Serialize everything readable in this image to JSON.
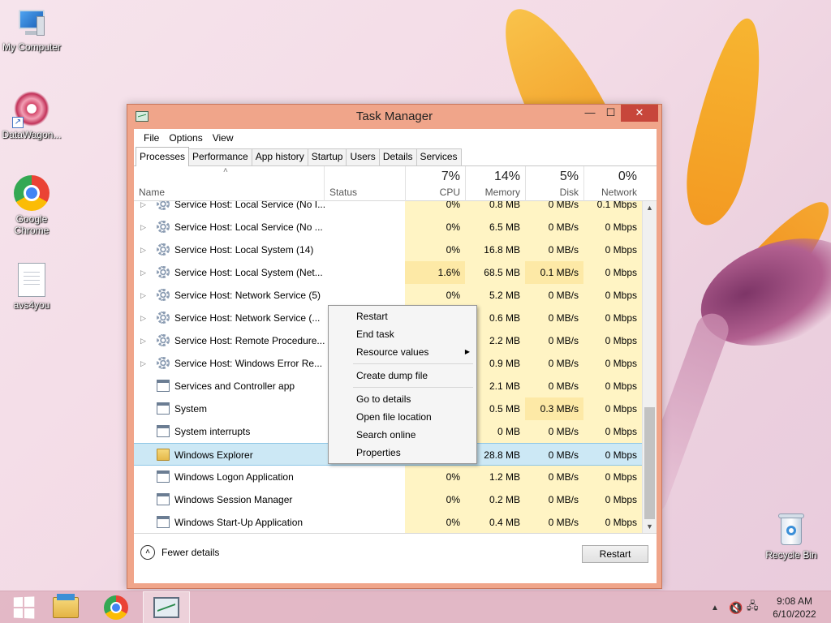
{
  "desktop": {
    "icons": [
      {
        "label": "My Computer"
      },
      {
        "label": "DataWagon..."
      },
      {
        "label": "Google Chrome"
      },
      {
        "label": "avs4you"
      },
      {
        "label": "Recycle Bin"
      }
    ]
  },
  "window": {
    "title": "Task Manager",
    "controls": {
      "minimize": "—",
      "maximize": "☐",
      "close": "✕"
    },
    "menu": [
      "File",
      "Options",
      "View"
    ],
    "tabs": [
      "Processes",
      "Performance",
      "App history",
      "Startup",
      "Users",
      "Details",
      "Services"
    ],
    "active_tab": "Processes",
    "columns": {
      "name": "Name",
      "status": "Status",
      "cpu": {
        "pct": "7%",
        "label": "CPU"
      },
      "memory": {
        "pct": "14%",
        "label": "Memory"
      },
      "disk": {
        "pct": "5%",
        "label": "Disk"
      },
      "network": {
        "pct": "0%",
        "label": "Network"
      }
    },
    "rows": [
      {
        "name": "Service Host: Local Service (No I...",
        "cpu": "0%",
        "memory": "0.8 MB",
        "disk": "0 MB/s",
        "network": "0.1 Mbps",
        "expand": true,
        "icon": "gear"
      },
      {
        "name": "Service Host: Local Service (No ...",
        "cpu": "0%",
        "memory": "6.5 MB",
        "disk": "0 MB/s",
        "network": "0 Mbps",
        "expand": true,
        "icon": "gear"
      },
      {
        "name": "Service Host: Local System (14)",
        "cpu": "0%",
        "memory": "16.8 MB",
        "disk": "0 MB/s",
        "network": "0 Mbps",
        "expand": true,
        "icon": "gear"
      },
      {
        "name": "Service Host: Local System (Net...",
        "cpu": "1.6%",
        "memory": "68.5 MB",
        "disk": "0.1 MB/s",
        "network": "0 Mbps",
        "expand": true,
        "icon": "gear"
      },
      {
        "name": "Service Host: Network Service (5)",
        "cpu": "0%",
        "memory": "5.2 MB",
        "disk": "0 MB/s",
        "network": "0 Mbps",
        "expand": true,
        "icon": "gear"
      },
      {
        "name": "Service Host: Network Service (...",
        "cpu": "",
        "memory": "0.6 MB",
        "disk": "0 MB/s",
        "network": "0 Mbps",
        "expand": true,
        "icon": "gear"
      },
      {
        "name": "Service Host: Remote Procedure...",
        "cpu": "",
        "memory": "2.2 MB",
        "disk": "0 MB/s",
        "network": "0 Mbps",
        "expand": true,
        "icon": "gear"
      },
      {
        "name": "Service Host: Windows Error Re...",
        "cpu": "",
        "memory": "0.9 MB",
        "disk": "0 MB/s",
        "network": "0 Mbps",
        "expand": true,
        "icon": "gear"
      },
      {
        "name": "Services and Controller app",
        "cpu": "",
        "memory": "2.1 MB",
        "disk": "0 MB/s",
        "network": "0 Mbps",
        "expand": false,
        "icon": "app"
      },
      {
        "name": "System",
        "cpu": "",
        "memory": "0.5 MB",
        "disk": "0.3 MB/s",
        "network": "0 Mbps",
        "expand": false,
        "icon": "app"
      },
      {
        "name": "System interrupts",
        "cpu": "",
        "memory": "0 MB",
        "disk": "0 MB/s",
        "network": "0 Mbps",
        "expand": false,
        "icon": "app"
      },
      {
        "name": "Windows Explorer",
        "cpu": "0%",
        "memory": "28.8 MB",
        "disk": "0 MB/s",
        "network": "0 Mbps",
        "expand": false,
        "icon": "folder",
        "selected": true
      },
      {
        "name": "Windows Logon Application",
        "cpu": "0%",
        "memory": "1.2 MB",
        "disk": "0 MB/s",
        "network": "0 Mbps",
        "expand": false,
        "icon": "app"
      },
      {
        "name": "Windows Session Manager",
        "cpu": "0%",
        "memory": "0.2 MB",
        "disk": "0 MB/s",
        "network": "0 Mbps",
        "expand": false,
        "icon": "app"
      },
      {
        "name": "Windows Start-Up Application",
        "cpu": "0%",
        "memory": "0.4 MB",
        "disk": "0 MB/s",
        "network": "0 Mbps",
        "expand": false,
        "icon": "app"
      }
    ],
    "footer": {
      "fewer_details": "Fewer details",
      "action_button": "Restart"
    }
  },
  "context_menu": {
    "items": [
      "Restart",
      "End task",
      "Resource values",
      "Create dump file",
      "Go to details",
      "Open file location",
      "Search online",
      "Properties"
    ]
  },
  "taskbar": {
    "time": "9:08 AM",
    "date": "6/10/2022"
  }
}
